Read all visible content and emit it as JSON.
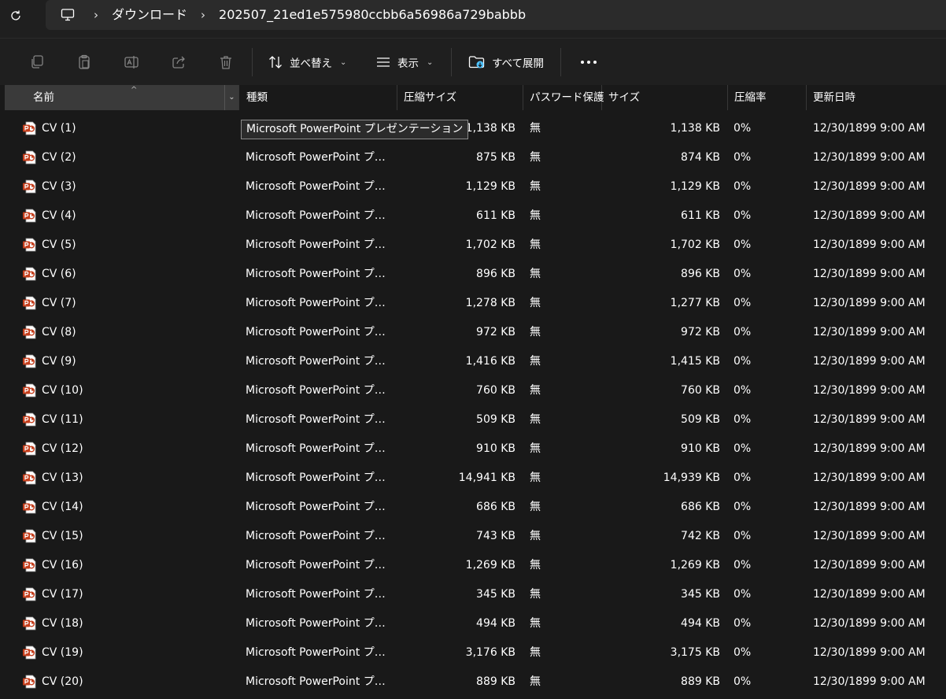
{
  "address_bar": {
    "crumbs": [
      "ダウンロード",
      "202507_21ed1e575980ccbb6a56986a729babbb"
    ],
    "separator": "›"
  },
  "command_bar": {
    "sort_label": "並べ替え",
    "view_label": "表示",
    "expand_all_label": "すべて展開"
  },
  "columns": {
    "name": "名前",
    "type": "種類",
    "compressed_size": "圧縮サイズ",
    "password": "パスワード保護",
    "size": "サイズ",
    "ratio": "圧縮率",
    "date": "更新日時"
  },
  "tooltip": "Microsoft PowerPoint プレゼンテーション",
  "files": [
    {
      "name": "CV (1)",
      "type": "Microsoft PowerPoint プレ...",
      "compressed_size": "1,138 KB",
      "password": "無",
      "size": "1,138 KB",
      "ratio": "0%",
      "date": "12/30/1899 9:00 AM"
    },
    {
      "name": "CV (2)",
      "type": "Microsoft PowerPoint プレ...",
      "compressed_size": "875 KB",
      "password": "無",
      "size": "874 KB",
      "ratio": "0%",
      "date": "12/30/1899 9:00 AM"
    },
    {
      "name": "CV (3)",
      "type": "Microsoft PowerPoint プレ...",
      "compressed_size": "1,129 KB",
      "password": "無",
      "size": "1,129 KB",
      "ratio": "0%",
      "date": "12/30/1899 9:00 AM"
    },
    {
      "name": "CV (4)",
      "type": "Microsoft PowerPoint プレ...",
      "compressed_size": "611 KB",
      "password": "無",
      "size": "611 KB",
      "ratio": "0%",
      "date": "12/30/1899 9:00 AM"
    },
    {
      "name": "CV (5)",
      "type": "Microsoft PowerPoint プレ...",
      "compressed_size": "1,702 KB",
      "password": "無",
      "size": "1,702 KB",
      "ratio": "0%",
      "date": "12/30/1899 9:00 AM"
    },
    {
      "name": "CV (6)",
      "type": "Microsoft PowerPoint プレ...",
      "compressed_size": "896 KB",
      "password": "無",
      "size": "896 KB",
      "ratio": "0%",
      "date": "12/30/1899 9:00 AM"
    },
    {
      "name": "CV (7)",
      "type": "Microsoft PowerPoint プレ...",
      "compressed_size": "1,278 KB",
      "password": "無",
      "size": "1,277 KB",
      "ratio": "0%",
      "date": "12/30/1899 9:00 AM"
    },
    {
      "name": "CV (8)",
      "type": "Microsoft PowerPoint プレ...",
      "compressed_size": "972 KB",
      "password": "無",
      "size": "972 KB",
      "ratio": "0%",
      "date": "12/30/1899 9:00 AM"
    },
    {
      "name": "CV (9)",
      "type": "Microsoft PowerPoint プレ...",
      "compressed_size": "1,416 KB",
      "password": "無",
      "size": "1,415 KB",
      "ratio": "0%",
      "date": "12/30/1899 9:00 AM"
    },
    {
      "name": "CV (10)",
      "type": "Microsoft PowerPoint プレ...",
      "compressed_size": "760 KB",
      "password": "無",
      "size": "760 KB",
      "ratio": "0%",
      "date": "12/30/1899 9:00 AM"
    },
    {
      "name": "CV (11)",
      "type": "Microsoft PowerPoint プレ...",
      "compressed_size": "509 KB",
      "password": "無",
      "size": "509 KB",
      "ratio": "0%",
      "date": "12/30/1899 9:00 AM"
    },
    {
      "name": "CV (12)",
      "type": "Microsoft PowerPoint プレ...",
      "compressed_size": "910 KB",
      "password": "無",
      "size": "910 KB",
      "ratio": "0%",
      "date": "12/30/1899 9:00 AM"
    },
    {
      "name": "CV (13)",
      "type": "Microsoft PowerPoint プレ...",
      "compressed_size": "14,941 KB",
      "password": "無",
      "size": "14,939 KB",
      "ratio": "0%",
      "date": "12/30/1899 9:00 AM"
    },
    {
      "name": "CV (14)",
      "type": "Microsoft PowerPoint プレ...",
      "compressed_size": "686 KB",
      "password": "無",
      "size": "686 KB",
      "ratio": "0%",
      "date": "12/30/1899 9:00 AM"
    },
    {
      "name": "CV (15)",
      "type": "Microsoft PowerPoint プレ...",
      "compressed_size": "743 KB",
      "password": "無",
      "size": "742 KB",
      "ratio": "0%",
      "date": "12/30/1899 9:00 AM"
    },
    {
      "name": "CV (16)",
      "type": "Microsoft PowerPoint プレ...",
      "compressed_size": "1,269 KB",
      "password": "無",
      "size": "1,269 KB",
      "ratio": "0%",
      "date": "12/30/1899 9:00 AM"
    },
    {
      "name": "CV (17)",
      "type": "Microsoft PowerPoint プレ...",
      "compressed_size": "345 KB",
      "password": "無",
      "size": "345 KB",
      "ratio": "0%",
      "date": "12/30/1899 9:00 AM"
    },
    {
      "name": "CV (18)",
      "type": "Microsoft PowerPoint プレ...",
      "compressed_size": "494 KB",
      "password": "無",
      "size": "494 KB",
      "ratio": "0%",
      "date": "12/30/1899 9:00 AM"
    },
    {
      "name": "CV (19)",
      "type": "Microsoft PowerPoint プレ...",
      "compressed_size": "3,176 KB",
      "password": "無",
      "size": "3,175 KB",
      "ratio": "0%",
      "date": "12/30/1899 9:00 AM"
    },
    {
      "name": "CV (20)",
      "type": "Microsoft PowerPoint プレ...",
      "compressed_size": "889 KB",
      "password": "無",
      "size": "889 KB",
      "ratio": "0%",
      "date": "12/30/1899 9:00 AM"
    }
  ],
  "colors": {
    "background": "#191919",
    "chrome": "#1f1f1f",
    "selected_column": "#3a3a3a",
    "ppt_icon": "#c43e1c",
    "accent": "#4cc2ff"
  }
}
